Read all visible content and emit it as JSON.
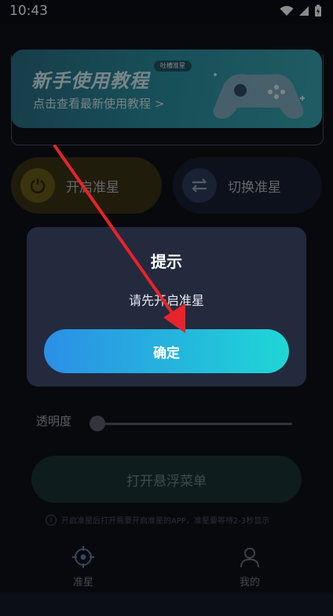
{
  "status_bar": {
    "time": "10:43"
  },
  "banner": {
    "title": "新手使用教程",
    "subtitle": "点击查看最新使用教程 >",
    "tag": "吐槽准星"
  },
  "buttons": {
    "enable_crosshair": "开启准星",
    "switch_crosshair": "切换准星",
    "open_floating_menu": "打开悬浮菜单"
  },
  "opacity": {
    "label": "透明度"
  },
  "tip": "开启准星后打开需要开启准星的APP，准星要等待2-3秒显示",
  "tabs": [
    {
      "label": "准星",
      "icon": "crosshair-icon"
    },
    {
      "label": "我的",
      "icon": "user-icon"
    }
  ],
  "dialog": {
    "title": "提示",
    "message": "请先开启准星",
    "confirm_label": "确定"
  },
  "colors": {
    "dialog_bg": "#232a3d",
    "confirm_gradient_start": "#2b8fe6",
    "confirm_gradient_end": "#1fd6d6",
    "annotation_arrow": "#e8232a"
  }
}
